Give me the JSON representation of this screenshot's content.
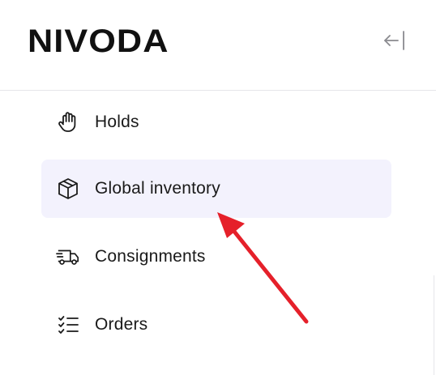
{
  "brand": {
    "logo_text": "NIVODA"
  },
  "header": {
    "collapse_icon": "collapse-left-icon"
  },
  "nav": {
    "items": [
      {
        "label": "Holds",
        "icon": "hand-icon",
        "active": false
      },
      {
        "label": "Global inventory",
        "icon": "box-icon",
        "active": true
      },
      {
        "label": "Consignments",
        "icon": "truck-icon",
        "active": false
      },
      {
        "label": "Orders",
        "icon": "checklist-icon",
        "active": false
      }
    ]
  },
  "annotation": {
    "arrow_color": "#e5202a",
    "active_bg": "#f3f2fd"
  }
}
